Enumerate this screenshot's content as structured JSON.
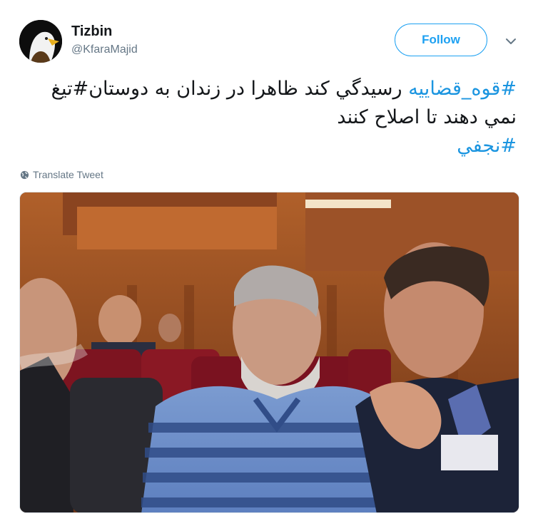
{
  "user": {
    "name": "Tizbin",
    "handle": "@KfaraMajid"
  },
  "follow_label": "Follow",
  "tweet": {
    "hashtag1": "#قوه_قضاييه",
    "line1_text": " رسيدگي كند ظاهرا در زندان به دوستان#تيغ",
    "line2_text": "نمي دهند تا اصلاح كنند",
    "hashtag2": "#نجفي"
  },
  "translate_label": "Translate Tweet",
  "icons": {
    "more": "chevron-down-icon",
    "translate": "globe-icon"
  },
  "colors": {
    "accent": "#1da1f2",
    "hashtag": "#1b95e0",
    "secondary_text": "#657786"
  }
}
